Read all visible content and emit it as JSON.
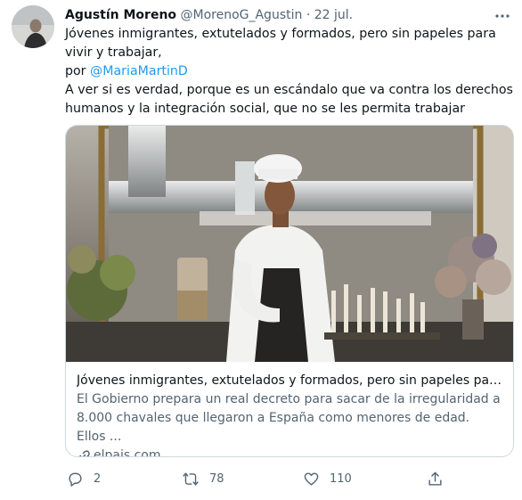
{
  "tweet": {
    "author_name": "Agustín Moreno",
    "handle": "@MorenoG_Agustin",
    "separator": "·",
    "date": "22 jul.",
    "line1": "Jóvenes inmigrantes, extutelados y formados, pero sin papeles para vivir y trabajar,",
    "via_prefix": "por",
    "mention": "@MariaMartinD",
    "line2": "A ver si es verdad, porque es un escándalo que va contra los derechos humanos y la integración social, que no se les permita trabajar"
  },
  "card": {
    "title": "Jóvenes inmigrantes, extutelados y formados, pero sin papeles para vivir y trabajar",
    "description": "El Gobierno prepara un real decreto para sacar de la irregularidad a 8.000 chavales que llegaron a España como menores de edad. Ellos ...",
    "domain": "elpais.com"
  },
  "actions": {
    "reply_count": "2",
    "retweet_count": "78",
    "like_count": "110"
  },
  "colors": {
    "accent": "#1d9bf0",
    "muted": "#536471",
    "border": "#cfd9de"
  },
  "icons": [
    "more-icon",
    "reply-icon",
    "retweet-icon",
    "like-icon",
    "share-icon",
    "link-icon"
  ]
}
